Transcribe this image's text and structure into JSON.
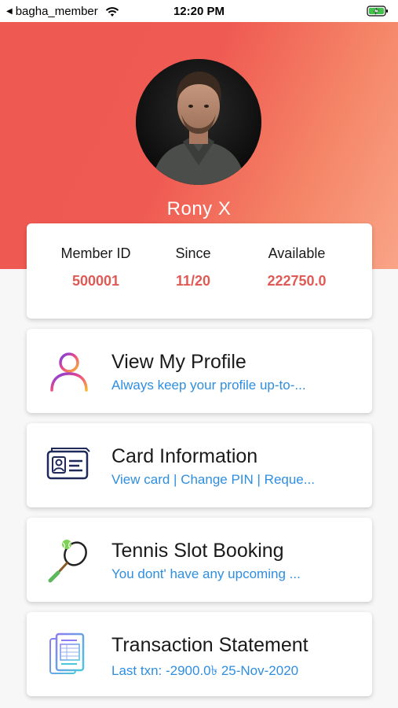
{
  "status_bar": {
    "back_app": "bagha_member",
    "time": "12:20 PM",
    "icons": [
      "caret-left-icon",
      "wifi-icon",
      "battery-charging-icon"
    ]
  },
  "profile": {
    "name": "Rony X"
  },
  "stats": {
    "member_id_label": "Member ID",
    "member_id_value": "500001",
    "since_label": "Since",
    "since_value": "11/20",
    "available_label": "Available",
    "available_value": "222750.0"
  },
  "menu": [
    {
      "title": "View My Profile",
      "subtitle": "Always keep your profile up-to-...",
      "icon": "user-profile-icon"
    },
    {
      "title": "Card Information",
      "subtitle": "View card | Change PIN | Reque...",
      "icon": "id-card-icon"
    },
    {
      "title": "Tennis Slot Booking",
      "subtitle": "You dont' have any upcoming ...",
      "icon": "tennis-racket-icon"
    },
    {
      "title": "Transaction Statement",
      "subtitle": "Last txn: -2900.0৳ 25-Nov-2020",
      "icon": "statement-document-icon"
    }
  ],
  "colors": {
    "header_gradient_start": "#ee5a52",
    "header_gradient_end": "#f9a487",
    "value_red": "#e05a55",
    "subtitle_blue": "#2f8ee0"
  }
}
